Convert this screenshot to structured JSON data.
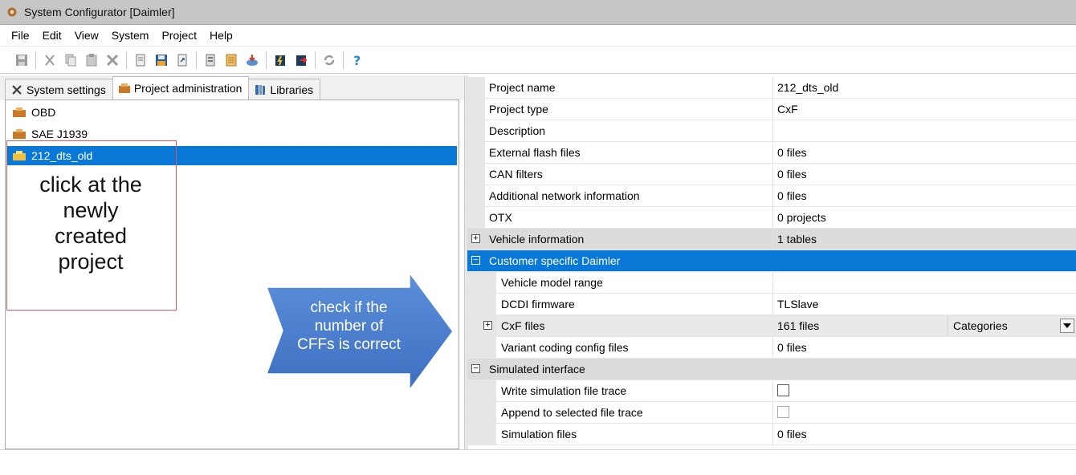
{
  "window": {
    "title": "System Configurator [Daimler]"
  },
  "menu": {
    "items": [
      "File",
      "Edit",
      "View",
      "System",
      "Project",
      "Help"
    ]
  },
  "toolbar": {
    "buttons": [
      "save-icon",
      "cut-icon",
      "copy-icon",
      "paste-icon",
      "delete-icon",
      "new-document-icon",
      "save-project-icon",
      "export-icon",
      "properties-icon",
      "report-icon",
      "import-icon",
      "flash-icon",
      "flash-send-icon",
      "refresh-icon",
      "help-icon"
    ]
  },
  "tabs": {
    "system_settings": "System settings",
    "project_administration": "Project administration",
    "libraries": "Libraries"
  },
  "tree": {
    "items": [
      "OBD",
      "SAE J1939",
      "212_dts_old"
    ],
    "selected": "212_dts_old"
  },
  "annotations": {
    "callout": "click at the\nnewly\ncreated\nproject",
    "arrow": "check if the\nnumber of\nCFFs is correct",
    "arrow_color": "#4a7fcf",
    "callout_border_color": "#cf5a5a"
  },
  "properties": {
    "project_name": {
      "name": "Project name",
      "value": "212_dts_old"
    },
    "project_type": {
      "name": "Project type",
      "value": "CxF"
    },
    "description": {
      "name": "Description",
      "value": ""
    },
    "external_flash": {
      "name": "External flash files",
      "value": "0 files"
    },
    "can_filters": {
      "name": "CAN filters",
      "value": "0 files"
    },
    "additional_network": {
      "name": "Additional network information",
      "value": "0 files"
    },
    "otx": {
      "name": "OTX",
      "value": "0 projects"
    },
    "vehicle_information": {
      "name": "Vehicle information",
      "value": "1 tables",
      "expander": "⊞"
    },
    "customer_specific": {
      "name": "Customer specific Daimler",
      "expander": "⊟"
    },
    "vehicle_model_range": {
      "name": "Vehicle model range",
      "value": ""
    },
    "dcdi_firmware": {
      "name": "DCDI firmware",
      "value": "TLSlave"
    },
    "cxf_files": {
      "name": "CxF files",
      "value": "161 files",
      "expander": "⊞",
      "categories": "Categories"
    },
    "variant_coding": {
      "name": "Variant coding config files",
      "value": "0 files"
    },
    "simulated_interface": {
      "name": "Simulated interface",
      "expander": "⊟"
    },
    "write_sim_trace": {
      "name": "Write simulation file trace",
      "checked": false
    },
    "append_trace": {
      "name": "Append to selected file trace",
      "checked": false
    },
    "simulation_files": {
      "name": "Simulation files",
      "value": "0 files"
    }
  },
  "colors": {
    "selection": "#0a78d7",
    "category_row": "#dcdcdc"
  }
}
